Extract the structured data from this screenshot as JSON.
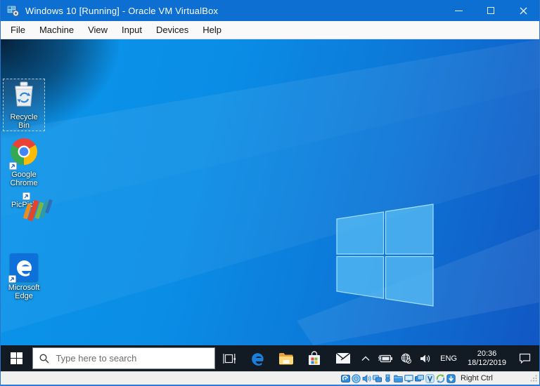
{
  "window": {
    "title": "Windows 10 [Running] - Oracle VM VirtualBox"
  },
  "menubar": {
    "items": [
      "File",
      "Machine",
      "View",
      "Input",
      "Devices",
      "Help"
    ]
  },
  "desktop": {
    "icons": [
      {
        "label": "Recycle Bin",
        "selected": true
      },
      {
        "label": "Google Chrome"
      },
      {
        "label": "PicPick"
      },
      {
        "label": "Microsoft Edge"
      }
    ]
  },
  "taskbar": {
    "search_placeholder": "Type here to search",
    "buttons": [
      "task-view",
      "microsoft-edge",
      "file-explorer",
      "microsoft-store",
      "mail"
    ],
    "tray": {
      "language": "ENG",
      "time": "20:36",
      "date": "18/12/2019"
    }
  },
  "statusbar": {
    "icons": [
      "hard-disks",
      "optical-drives",
      "audio",
      "network",
      "usb",
      "shared-folders",
      "display",
      "recording",
      "features",
      "mouse-integration",
      "keyboard"
    ],
    "host_key_label": "Right Ctrl"
  },
  "colors": {
    "titlebar": "#0c6fd1",
    "guest_taskbar": "#121a24",
    "wallpaper_accent": "#0b95ea",
    "logo_pane": "#45b2ef"
  }
}
